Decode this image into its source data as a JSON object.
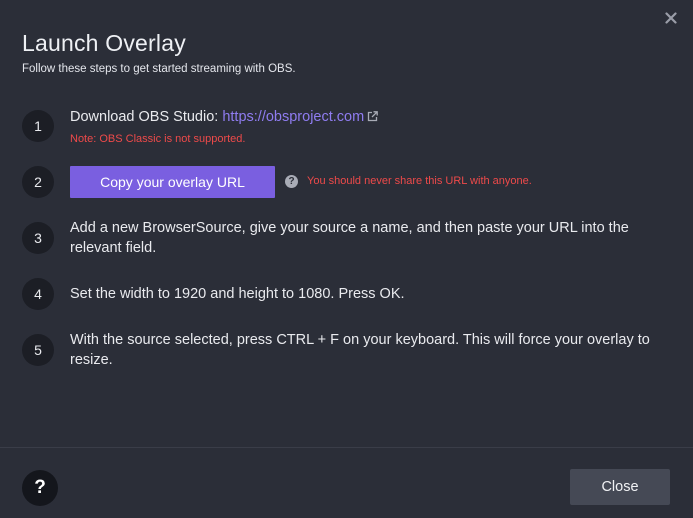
{
  "modal": {
    "title": "Launch Overlay",
    "subtitle": "Follow these steps to get started streaming with OBS.",
    "close_icon": "close-x-icon"
  },
  "steps": [
    {
      "number": "1",
      "text": "Download OBS Studio:",
      "link_text": "https://obsproject.com",
      "link_icon": "external-link-icon",
      "note": "Note: OBS Classic is not supported."
    },
    {
      "number": "2",
      "button_label": "Copy your overlay URL",
      "help_icon": "question-circle-icon",
      "help_glyph": "?",
      "warning": "You should never share this URL with anyone."
    },
    {
      "number": "3",
      "text": "Add a new BrowserSource, give your source a name, and then paste your URL into the relevant field."
    },
    {
      "number": "4",
      "text": "Set the width to 1920 and height to 1080. Press OK."
    },
    {
      "number": "5",
      "text": "With the source selected, press CTRL + F on your keyboard. This will force your overlay to resize."
    }
  ],
  "footer": {
    "help_glyph": "?",
    "help_icon": "question-circle-icon",
    "close_label": "Close"
  },
  "colors": {
    "background": "#2b2e38",
    "accent": "#7a5fe0",
    "link": "#8f7cf0",
    "warning": "#ee4a4a",
    "close_button": "#454955"
  }
}
